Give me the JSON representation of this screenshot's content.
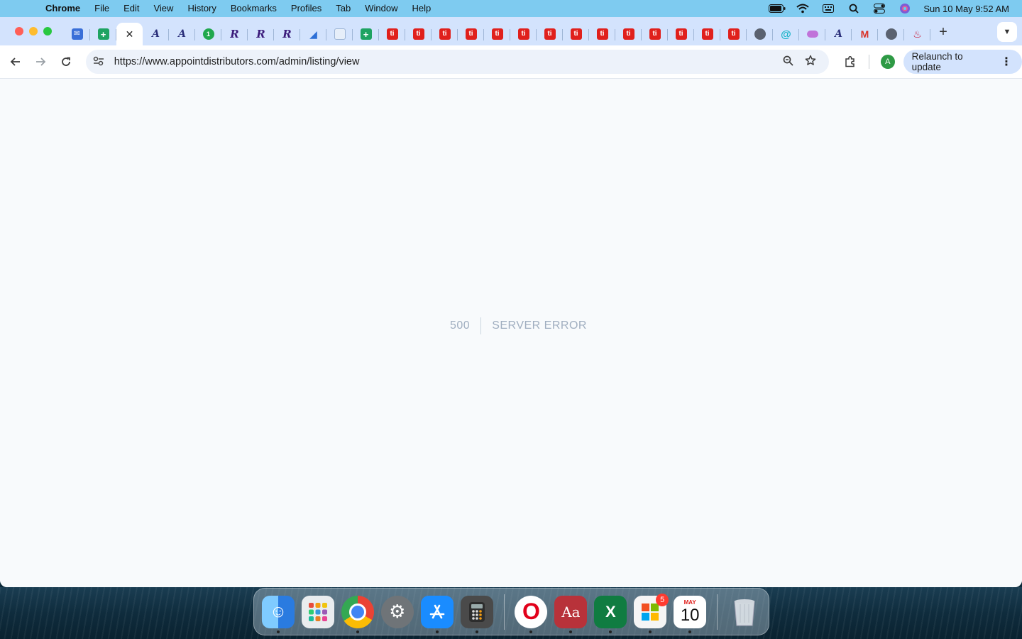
{
  "menubar": {
    "app_name": "Chrome",
    "items": [
      "File",
      "Edit",
      "View",
      "History",
      "Bookmarks",
      "Profiles",
      "Tab",
      "Window",
      "Help"
    ],
    "clock": "Sun 10 May  9:52 AM"
  },
  "tabs": [
    {
      "icon": "mail-icon",
      "glyph": "✉",
      "kind": "mail"
    },
    {
      "icon": "sheet-icon",
      "glyph": "+",
      "kind": "sheet"
    },
    {
      "icon": "close-icon",
      "glyph": "✕",
      "kind": "active"
    },
    {
      "icon": "pen-icon",
      "glyph": "A",
      "kind": "pen"
    },
    {
      "icon": "pen-icon",
      "glyph": "A",
      "kind": "pen"
    },
    {
      "icon": "one-icon",
      "glyph": "1",
      "kind": "one"
    },
    {
      "icon": "rr-icon",
      "glyph": "R",
      "kind": "rr"
    },
    {
      "icon": "rr-icon",
      "glyph": "R",
      "kind": "rr"
    },
    {
      "icon": "rr-icon",
      "glyph": "R",
      "kind": "rr"
    },
    {
      "icon": "sail-icon",
      "glyph": "◢",
      "kind": "sail"
    },
    {
      "icon": "doc-icon",
      "glyph": "",
      "kind": "doc"
    },
    {
      "icon": "sheet-icon",
      "glyph": "+",
      "kind": "sheet"
    },
    {
      "icon": "ti-icon",
      "glyph": "ti",
      "kind": "ti"
    },
    {
      "icon": "ti-icon",
      "glyph": "ti",
      "kind": "ti"
    },
    {
      "icon": "ti-icon",
      "glyph": "ti",
      "kind": "ti"
    },
    {
      "icon": "ti-icon",
      "glyph": "ti",
      "kind": "ti"
    },
    {
      "icon": "ti-icon",
      "glyph": "ti",
      "kind": "ti"
    },
    {
      "icon": "ti-icon",
      "glyph": "ti",
      "kind": "ti"
    },
    {
      "icon": "ti-icon",
      "glyph": "ti",
      "kind": "ti"
    },
    {
      "icon": "ti-icon",
      "glyph": "ti",
      "kind": "ti"
    },
    {
      "icon": "ti-icon",
      "glyph": "ti",
      "kind": "ti"
    },
    {
      "icon": "ti-icon",
      "glyph": "ti",
      "kind": "ti"
    },
    {
      "icon": "ti-icon",
      "glyph": "ti",
      "kind": "ti"
    },
    {
      "icon": "ti-icon",
      "glyph": "ti",
      "kind": "ti"
    },
    {
      "icon": "ti-icon",
      "glyph": "ti",
      "kind": "ti"
    },
    {
      "icon": "ti-icon",
      "glyph": "ti",
      "kind": "ti"
    },
    {
      "icon": "globe-icon",
      "glyph": "",
      "kind": "globe"
    },
    {
      "icon": "swirl-icon",
      "glyph": "@",
      "kind": "swirl"
    },
    {
      "icon": "cloud-icon",
      "glyph": "",
      "kind": "cloud"
    },
    {
      "icon": "pen-icon",
      "glyph": "A",
      "kind": "pen"
    },
    {
      "icon": "gmail-icon",
      "glyph": "M",
      "kind": "gmail"
    },
    {
      "icon": "globe-icon",
      "glyph": "",
      "kind": "globe"
    },
    {
      "icon": "flame-icon",
      "glyph": "♨",
      "kind": "flame"
    }
  ],
  "toolbar": {
    "url": "https://www.appointdistributors.com/admin/listing/view",
    "relaunch_label": "Relaunch to update",
    "avatar_letter": "A"
  },
  "error": {
    "code": "500",
    "message": "Server Error"
  },
  "dock": {
    "office_badge": "5",
    "calendar_month": "MAY",
    "calendar_day": "10",
    "dictionary_label": "Aa"
  },
  "colors": {
    "menubar": "#7ecbf0",
    "tabstrip": "#d3e3fd",
    "page_bg": "#f8fafc",
    "error_text": "#a0aec0"
  }
}
